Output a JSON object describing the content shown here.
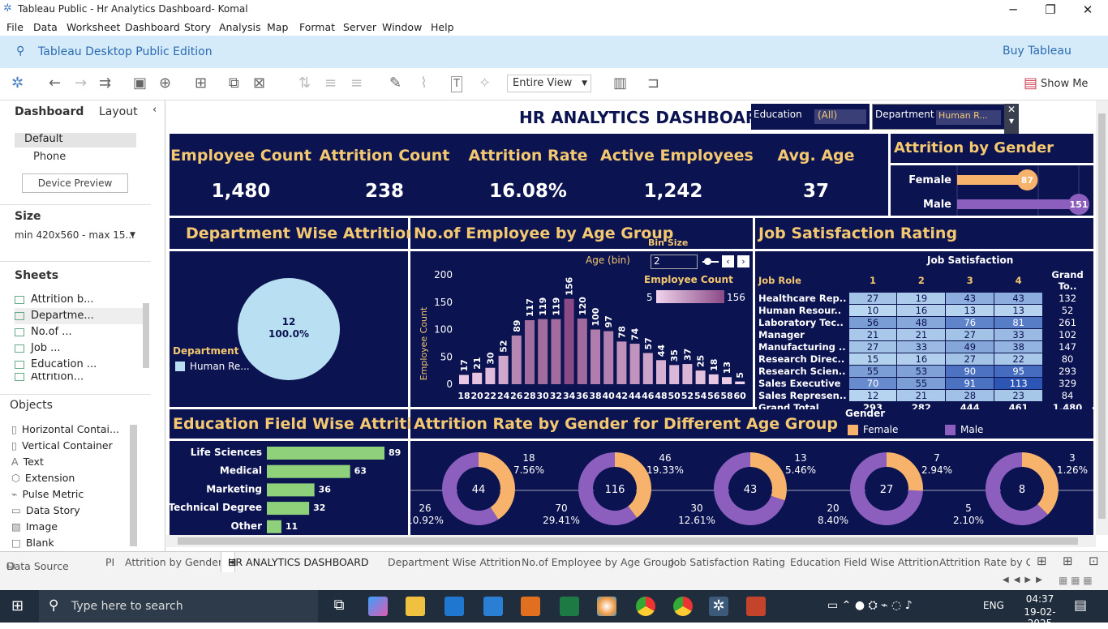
{
  "window": {
    "title": "Tableau Public - Hr Analytics Dashboard- Komal",
    "minimize": "─",
    "restore": "❐",
    "close": "✕"
  },
  "menu": [
    "File",
    "Data",
    "Worksheet",
    "Dashboard",
    "Story",
    "Analysis",
    "Map",
    "Format",
    "Server",
    "Window",
    "Help"
  ],
  "banner": {
    "edition": "Tableau Desktop Public Edition",
    "buy": "Buy Tableau"
  },
  "toolbar": {
    "view_select": "Entire View",
    "show_me": "Show Me"
  },
  "left_panel": {
    "tab_dashboard": "Dashboard",
    "tab_layout": "Layout",
    "devices": [
      "Default",
      "Phone"
    ],
    "device_preview": "Device Preview",
    "size_label": "Size",
    "size_value": "min 420x560 - max 15...",
    "sheets_label": "Sheets",
    "sheets": [
      "Attrition b...",
      "Departme...",
      "No.of ...",
      "Job ...",
      "Education ...",
      "Attrition..."
    ],
    "objects_label": "Objects",
    "objects": [
      "Horizontal Contai...",
      "Vertical Container",
      "Text",
      "Extension",
      "Pulse Metric",
      "Data Story",
      "Image",
      "Blank"
    ]
  },
  "dashboard": {
    "title": "HR ANALYTICS DASHBOARD",
    "filters": {
      "education_label": "Education",
      "education_value": "(All)",
      "department_label": "Department",
      "department_value": "Human R..."
    },
    "kpis": [
      {
        "label": "Employee Count",
        "value": "1,480"
      },
      {
        "label": "Attrition Count",
        "value": "238"
      },
      {
        "label": "Attrition Rate",
        "value": "16.08%"
      },
      {
        "label": "Active Employees",
        "value": "1,242"
      },
      {
        "label": "Avg. Age",
        "value": "37"
      }
    ],
    "gender_panel": {
      "title": "Attrition by Gender",
      "rows": [
        {
          "label": "Female",
          "value": 87,
          "color": "#f7b26b"
        },
        {
          "label": "Male",
          "value": 151,
          "color": "#8c5fbf"
        }
      ]
    },
    "dept_panel": {
      "title": "Department Wise Attrition",
      "slice_count": "12",
      "slice_pct": "100.0%",
      "legend_title": "Department",
      "legend_item": "Human Re..."
    },
    "age_panel": {
      "title": "No.of Employee by Age Group",
      "bin_size_label": "Bin Size",
      "bin_value": "2",
      "age_bin_label": "Age (bin)",
      "ylabel": "Employee Count",
      "legend_title": "Employee Count",
      "legend_min": "5",
      "legend_max": "156"
    },
    "job_panel": {
      "title": "Job Satisfaction Rating",
      "group_header": "Job Satisfaction",
      "col_role": "Job Role",
      "cols": [
        "1",
        "2",
        "3",
        "4",
        "Grand To.."
      ],
      "rows": [
        {
          "role": "Healthcare Rep..",
          "v": [
            "27",
            "19",
            "43",
            "43",
            "132"
          ]
        },
        {
          "role": "Human Resour..",
          "v": [
            "10",
            "16",
            "13",
            "13",
            "52"
          ]
        },
        {
          "role": "Laboratory Tec..",
          "v": [
            "56",
            "48",
            "76",
            "81",
            "261"
          ]
        },
        {
          "role": "Manager",
          "v": [
            "21",
            "21",
            "27",
            "33",
            "102"
          ]
        },
        {
          "role": "Manufacturing ..",
          "v": [
            "27",
            "33",
            "49",
            "38",
            "147"
          ]
        },
        {
          "role": "Research Direc..",
          "v": [
            "15",
            "16",
            "27",
            "22",
            "80"
          ]
        },
        {
          "role": "Research Scien..",
          "v": [
            "55",
            "53",
            "90",
            "95",
            "293"
          ]
        },
        {
          "role": "Sales Executive",
          "v": [
            "70",
            "55",
            "91",
            "113",
            "329"
          ]
        },
        {
          "role": "Sales Represen..",
          "v": [
            "12",
            "21",
            "28",
            "23",
            "84"
          ]
        }
      ],
      "total": {
        "role": "Grand Total",
        "v": [
          "293",
          "282",
          "444",
          "461",
          "1,480"
        ]
      }
    },
    "edu_panel": {
      "title": "Education Field Wise Attrition"
    },
    "donut_panel": {
      "title": "Attrition Rate by Gender for Different Age Group",
      "legend_title": "Gender",
      "legend": [
        "Female",
        "Male"
      ],
      "donuts": [
        {
          "center": "44",
          "female": "18",
          "female_pct": "7.56%",
          "male": "26",
          "male_pct": "10.92%"
        },
        {
          "center": "116",
          "female": "46",
          "female_pct": "19.33%",
          "male": "70",
          "male_pct": "29.41%"
        },
        {
          "center": "43",
          "female": "13",
          "female_pct": "5.46%",
          "male": "30",
          "male_pct": "12.61%"
        },
        {
          "center": "27",
          "female": "7",
          "female_pct": "2.94%",
          "male": "20",
          "male_pct": "8.40%"
        },
        {
          "center": "8",
          "female": "3",
          "female_pct": "1.26%",
          "male": "5",
          "male_pct": "2.10%"
        }
      ]
    }
  },
  "sheet_tabs": [
    "Data Source",
    "PI",
    "Attrition by Gender",
    "HR ANALYTICS DASHBOARD",
    "Department Wise Attrition",
    "No.of Employee by Age Group",
    "Job Satisfaction Rating",
    "Education Field Wise Attrition",
    "Attrition Rate by Ger"
  ],
  "taskbar": {
    "search": "Type here to search",
    "time": "04:37",
    "date": "19-02-2025",
    "lang": "ENG"
  },
  "colors": {
    "navy": "#0b1350",
    "gold": "#f4c870",
    "female": "#f7b26b",
    "male": "#8c5fbf",
    "edu_bar": "#8fd07a",
    "pie": "#b9dff2"
  },
  "chart_data": [
    {
      "type": "bar",
      "title": "No.of Employee by Age Group",
      "xlabel": "Age (bin)",
      "ylabel": "Employee Count",
      "ylim": [
        0,
        200
      ],
      "categories": [
        "18",
        "20",
        "22",
        "24",
        "26",
        "28",
        "30",
        "32",
        "34",
        "36",
        "38",
        "40",
        "42",
        "44",
        "46",
        "48",
        "50",
        "52",
        "54",
        "56",
        "58",
        "60"
      ],
      "values": [
        17,
        21,
        30,
        52,
        89,
        117,
        119,
        119,
        156,
        120,
        100,
        97,
        78,
        74,
        57,
        44,
        35,
        37,
        25,
        18,
        13,
        5
      ]
    },
    {
      "type": "bar",
      "title": "Education Field Wise Attrition",
      "categories": [
        "Life Sciences",
        "Medical",
        "Marketing",
        "Technical Degree",
        "Other"
      ],
      "values": [
        89,
        63,
        36,
        32,
        11
      ]
    },
    {
      "type": "bar",
      "title": "Attrition by Gender",
      "categories": [
        "Female",
        "Male"
      ],
      "values": [
        87,
        151
      ]
    },
    {
      "type": "pie",
      "title": "Department Wise Attrition",
      "categories": [
        "Human Re..."
      ],
      "values": [
        12
      ]
    }
  ]
}
